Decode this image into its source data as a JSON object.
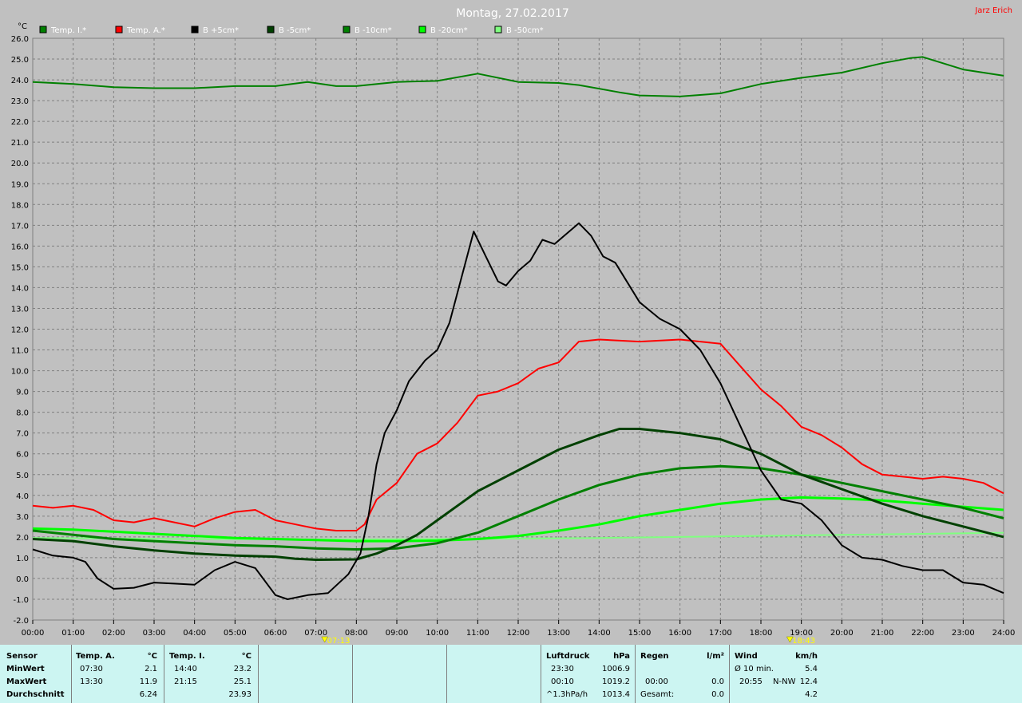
{
  "chart_data": {
    "type": "line",
    "title": "Montag, 27.02.2017",
    "author": "Jarz Erich",
    "ylabel": "°C",
    "ylim": [
      -2,
      26
    ],
    "yticks": [
      "26.0",
      "25.0",
      "24.0",
      "23.0",
      "22.0",
      "21.0",
      "20.0",
      "19.0",
      "18.0",
      "17.0",
      "16.0",
      "15.0",
      "14.0",
      "13.0",
      "12.0",
      "11.0",
      "10.0",
      "9.0",
      "8.0",
      "7.0",
      "6.0",
      "5.0",
      "4.0",
      "3.0",
      "2.0",
      "1.0",
      "0.0",
      "-1.0",
      "-2.0"
    ],
    "xlim": [
      0,
      24
    ],
    "xticks": [
      "00:00",
      "01:00",
      "02:00",
      "03:00",
      "04:00",
      "05:00",
      "06:00",
      "07:00",
      "08:00",
      "09:00",
      "10:00",
      "11:00",
      "12:00",
      "13:00",
      "14:00",
      "15:00",
      "16:00",
      "17:00",
      "18:00",
      "19:00",
      "20:00",
      "21:00",
      "22:00",
      "23:00",
      "24:00"
    ],
    "grid": true,
    "legend_position": "top",
    "sunrise": "07:13",
    "sunset": "18:43",
    "series": [
      {
        "name": "Temp. I.*",
        "color": "#008000",
        "width": 2,
        "points": [
          [
            0,
            23.9
          ],
          [
            1,
            23.8
          ],
          [
            2,
            23.65
          ],
          [
            3,
            23.6
          ],
          [
            4,
            23.6
          ],
          [
            5,
            23.7
          ],
          [
            6,
            23.7
          ],
          [
            6.8,
            23.9
          ],
          [
            7.5,
            23.7
          ],
          [
            8,
            23.7
          ],
          [
            9,
            23.9
          ],
          [
            10,
            23.95
          ],
          [
            11,
            24.3
          ],
          [
            12,
            23.9
          ],
          [
            13,
            23.85
          ],
          [
            13.5,
            23.75
          ],
          [
            14.5,
            23.4
          ],
          [
            15,
            23.25
          ],
          [
            16,
            23.2
          ],
          [
            17,
            23.35
          ],
          [
            18,
            23.8
          ],
          [
            19,
            24.1
          ],
          [
            20,
            24.35
          ],
          [
            21,
            24.8
          ],
          [
            21.7,
            25.05
          ],
          [
            22,
            25.1
          ],
          [
            23,
            24.5
          ],
          [
            24,
            24.2
          ]
        ]
      },
      {
        "name": "Temp. A.*",
        "color": "#ff0000",
        "width": 2,
        "points": [
          [
            0,
            3.5
          ],
          [
            0.5,
            3.4
          ],
          [
            1,
            3.5
          ],
          [
            1.5,
            3.3
          ],
          [
            2,
            2.8
          ],
          [
            2.5,
            2.7
          ],
          [
            3,
            2.9
          ],
          [
            3.5,
            2.7
          ],
          [
            4,
            2.5
          ],
          [
            4.5,
            2.9
          ],
          [
            5,
            3.2
          ],
          [
            5.5,
            3.3
          ],
          [
            6,
            2.8
          ],
          [
            6.5,
            2.6
          ],
          [
            7,
            2.4
          ],
          [
            7.5,
            2.3
          ],
          [
            8,
            2.3
          ],
          [
            8.2,
            2.6
          ],
          [
            8.5,
            3.8
          ],
          [
            9,
            4.6
          ],
          [
            9.5,
            6.0
          ],
          [
            10,
            6.5
          ],
          [
            10.5,
            7.5
          ],
          [
            11,
            8.8
          ],
          [
            11.5,
            9.0
          ],
          [
            12,
            9.4
          ],
          [
            12.5,
            10.1
          ],
          [
            13,
            10.4
          ],
          [
            13.5,
            11.4
          ],
          [
            14,
            11.5
          ],
          [
            15,
            11.4
          ],
          [
            16,
            11.5
          ],
          [
            16.5,
            11.4
          ],
          [
            17,
            11.3
          ],
          [
            17.5,
            10.2
          ],
          [
            18,
            9.1
          ],
          [
            18.5,
            8.3
          ],
          [
            19,
            7.3
          ],
          [
            19.5,
            6.9
          ],
          [
            20,
            6.3
          ],
          [
            20.5,
            5.5
          ],
          [
            21,
            5.0
          ],
          [
            22,
            4.8
          ],
          [
            22.5,
            4.9
          ],
          [
            23,
            4.8
          ],
          [
            23.5,
            4.6
          ],
          [
            24,
            4.1
          ]
        ]
      },
      {
        "name": "B +5cm*",
        "color": "#000000",
        "width": 2,
        "points": [
          [
            0,
            1.4
          ],
          [
            0.5,
            1.1
          ],
          [
            1,
            1.0
          ],
          [
            1.3,
            0.8
          ],
          [
            1.6,
            0.0
          ],
          [
            2,
            -0.5
          ],
          [
            2.5,
            -0.45
          ],
          [
            3,
            -0.2
          ],
          [
            3.5,
            -0.25
          ],
          [
            4,
            -0.3
          ],
          [
            4.5,
            0.4
          ],
          [
            5,
            0.8
          ],
          [
            5.5,
            0.5
          ],
          [
            6,
            -0.8
          ],
          [
            6.3,
            -1.0
          ],
          [
            6.8,
            -0.8
          ],
          [
            7.3,
            -0.7
          ],
          [
            7.8,
            0.2
          ],
          [
            8.1,
            1.2
          ],
          [
            8.3,
            3.0
          ],
          [
            8.5,
            5.5
          ],
          [
            8.7,
            7.0
          ],
          [
            9,
            8.1
          ],
          [
            9.3,
            9.5
          ],
          [
            9.7,
            10.5
          ],
          [
            10,
            11.0
          ],
          [
            10.3,
            12.3
          ],
          [
            10.6,
            14.5
          ],
          [
            10.9,
            16.7
          ],
          [
            11.2,
            15.5
          ],
          [
            11.5,
            14.3
          ],
          [
            11.7,
            14.1
          ],
          [
            12,
            14.8
          ],
          [
            12.3,
            15.3
          ],
          [
            12.6,
            16.3
          ],
          [
            12.9,
            16.1
          ],
          [
            13.2,
            16.6
          ],
          [
            13.5,
            17.1
          ],
          [
            13.8,
            16.5
          ],
          [
            14.1,
            15.5
          ],
          [
            14.4,
            15.2
          ],
          [
            15,
            13.3
          ],
          [
            15.5,
            12.5
          ],
          [
            16,
            12.0
          ],
          [
            16.5,
            11.0
          ],
          [
            17,
            9.4
          ],
          [
            17.5,
            7.3
          ],
          [
            18,
            5.2
          ],
          [
            18.5,
            3.8
          ],
          [
            19,
            3.6
          ],
          [
            19.5,
            2.8
          ],
          [
            20,
            1.6
          ],
          [
            20.5,
            1.0
          ],
          [
            21,
            0.9
          ],
          [
            21.5,
            0.6
          ],
          [
            22,
            0.4
          ],
          [
            22.5,
            0.4
          ],
          [
            23,
            -0.2
          ],
          [
            23.5,
            -0.3
          ],
          [
            24,
            -0.7
          ]
        ]
      },
      {
        "name": "B -5cm*",
        "color": "#004000",
        "width": 3,
        "points": [
          [
            0,
            1.9
          ],
          [
            1,
            1.8
          ],
          [
            2,
            1.55
          ],
          [
            3,
            1.35
          ],
          [
            4,
            1.2
          ],
          [
            5,
            1.1
          ],
          [
            6,
            1.05
          ],
          [
            6.5,
            0.95
          ],
          [
            7,
            0.9
          ],
          [
            8,
            0.92
          ],
          [
            8.5,
            1.2
          ],
          [
            9,
            1.6
          ],
          [
            9.5,
            2.1
          ],
          [
            10,
            2.8
          ],
          [
            10.5,
            3.5
          ],
          [
            11,
            4.2
          ],
          [
            12,
            5.2
          ],
          [
            13,
            6.2
          ],
          [
            14,
            6.9
          ],
          [
            14.5,
            7.2
          ],
          [
            15,
            7.2
          ],
          [
            16,
            7.0
          ],
          [
            17,
            6.7
          ],
          [
            18,
            6.0
          ],
          [
            19,
            5.0
          ],
          [
            20,
            4.3
          ],
          [
            21,
            3.6
          ],
          [
            22,
            3.0
          ],
          [
            23,
            2.5
          ],
          [
            24,
            2.0
          ]
        ]
      },
      {
        "name": "B -10cm*",
        "color": "#008000",
        "width": 3,
        "points": [
          [
            0,
            2.3
          ],
          [
            1,
            2.1
          ],
          [
            2,
            1.9
          ],
          [
            3,
            1.8
          ],
          [
            4,
            1.7
          ],
          [
            5,
            1.6
          ],
          [
            6,
            1.55
          ],
          [
            7,
            1.45
          ],
          [
            8,
            1.4
          ],
          [
            9,
            1.45
          ],
          [
            10,
            1.7
          ],
          [
            11,
            2.2
          ],
          [
            12,
            3.0
          ],
          [
            13,
            3.8
          ],
          [
            14,
            4.5
          ],
          [
            15,
            5.0
          ],
          [
            16,
            5.3
          ],
          [
            17,
            5.4
          ],
          [
            18,
            5.3
          ],
          [
            19,
            5.0
          ],
          [
            20,
            4.6
          ],
          [
            21,
            4.2
          ],
          [
            22,
            3.8
          ],
          [
            23,
            3.4
          ],
          [
            24,
            2.9
          ]
        ]
      },
      {
        "name": "B -20cm*",
        "color": "#00ff00",
        "width": 3,
        "points": [
          [
            0,
            2.4
          ],
          [
            1,
            2.35
          ],
          [
            2,
            2.25
          ],
          [
            3,
            2.15
          ],
          [
            4,
            2.05
          ],
          [
            5,
            1.95
          ],
          [
            6,
            1.9
          ],
          [
            7,
            1.85
          ],
          [
            8,
            1.8
          ],
          [
            9,
            1.8
          ],
          [
            10,
            1.82
          ],
          [
            11,
            1.9
          ],
          [
            12,
            2.05
          ],
          [
            13,
            2.3
          ],
          [
            14,
            2.6
          ],
          [
            15,
            3.0
          ],
          [
            16,
            3.3
          ],
          [
            17,
            3.6
          ],
          [
            18,
            3.8
          ],
          [
            19,
            3.9
          ],
          [
            20,
            3.85
          ],
          [
            21,
            3.75
          ],
          [
            22,
            3.6
          ],
          [
            23,
            3.45
          ],
          [
            24,
            3.3
          ]
        ]
      },
      {
        "name": "B -50cm*",
        "color": "#80ff80",
        "width": 2,
        "points": [
          [
            0,
            1.95
          ],
          [
            2,
            1.93
          ],
          [
            4,
            1.9
          ],
          [
            6,
            1.88
          ],
          [
            8,
            1.88
          ],
          [
            10,
            1.9
          ],
          [
            12,
            1.92
          ],
          [
            14,
            1.95
          ],
          [
            16,
            2.0
          ],
          [
            18,
            2.05
          ],
          [
            20,
            2.1
          ],
          [
            22,
            2.15
          ],
          [
            24,
            2.2
          ]
        ]
      }
    ]
  },
  "stats": {
    "sensor_header": "Sensor",
    "row_labels": [
      "MinWert",
      "MaxWert",
      "Durchschnitt"
    ],
    "temp_a": {
      "title": "Temp. A.",
      "unit": "°C",
      "min_time": "07:30",
      "min": "2.1",
      "max_time": "13:30",
      "max": "11.9",
      "avg": "6.24"
    },
    "temp_i": {
      "title": "Temp. I.",
      "unit": "°C",
      "min_time": "14:40",
      "min": "23.2",
      "max_time": "21:15",
      "max": "25.1",
      "avg": "23.93"
    },
    "pressure": {
      "title": "Luftdruck",
      "unit": "hPa",
      "min_time": "23:30",
      "min": "1006.9",
      "max_time": "00:10",
      "max": "1019.2",
      "trend": "^1.3hPa/h",
      "trend_val": "1013.4"
    },
    "rain": {
      "title": "Regen",
      "unit": "l/m²",
      "time": "00:00",
      "value": "0.0",
      "total_label": "Gesamt:",
      "total": "0.0"
    },
    "wind": {
      "title": "Wind",
      "unit": "km/h",
      "avg_label": "Ø 10 min.",
      "avg": "5.4",
      "gust_time": "20:55",
      "gust_dir": "N-NW",
      "gust": "12.4",
      "last": "4.2"
    }
  }
}
